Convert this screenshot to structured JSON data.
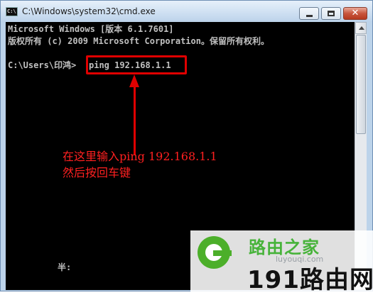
{
  "window": {
    "title": "C:\\Windows\\system32\\cmd.exe",
    "icon": "cmd-icon",
    "controls": {
      "minimize": "minimize-icon",
      "maximize": "maximize-icon",
      "close_glyph": "✕"
    }
  },
  "console": {
    "lines": [
      "Microsoft Windows [版本 6.1.7601]",
      "版权所有 (c) 2009 Microsoft Corporation。保留所有权利。",
      "C:\\Users\\印鸿>",
      "ping 192.168.1.1"
    ],
    "bottom_text": "半:"
  },
  "annotation": {
    "line1": "在这里输入ping 192.168.1.1",
    "line2": "然后按回车键",
    "color": "#ff2020"
  },
  "watermark": {
    "site_name": "路由之家",
    "url": "luyouqi.com",
    "brand": "191路由网",
    "brand_color": "#47b33a"
  }
}
